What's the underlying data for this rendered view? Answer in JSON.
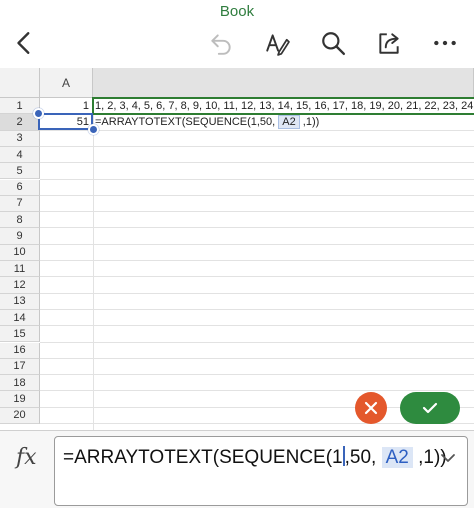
{
  "app": {
    "title": "Book"
  },
  "toolbar": {
    "icons": [
      "back-icon",
      "undo-icon",
      "format-icon",
      "search-icon",
      "share-icon",
      "more-icon"
    ]
  },
  "grid": {
    "column_header": "A",
    "row_numbers": [
      "1",
      "2",
      "3",
      "4",
      "5",
      "6",
      "7",
      "8",
      "9",
      "10",
      "11",
      "12",
      "13",
      "14",
      "15",
      "16",
      "17",
      "18",
      "19",
      "20"
    ],
    "active_row": "2",
    "cells": {
      "a1": "1",
      "b1": "1, 2, 3, 4, 5, 6, 7, 8, 9, 10, 11, 12, 13, 14, 15, 16, 17, 18, 19, 20, 21, 22, 23, 24,",
      "a2": "51",
      "b2_prefix": "=ARRAYTOTEXT(SEQUENCE(1,50, ",
      "b2_ref": "A2",
      "b2_suffix": " ,1))"
    }
  },
  "formula_bar": {
    "fx_label": "fx",
    "text_before_caret": "=ARRAYTOTEXT(SEQUENCE(1",
    "text_after_caret": ",50, ",
    "ref": "A2",
    "text_end": " ,1))"
  },
  "colors": {
    "brand_green": "#2e8b3f",
    "cancel_orange": "#e4582c",
    "selection_blue": "#3a64b9"
  }
}
